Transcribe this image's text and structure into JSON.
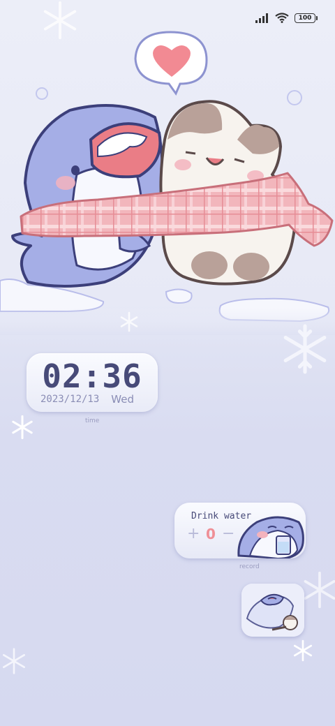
{
  "status_bar": {
    "battery": "100",
    "icons": [
      "signal-icon",
      "wifi-icon",
      "battery-icon"
    ]
  },
  "clock": {
    "time": "02:36",
    "date": "2023/12/13",
    "day": "Wed",
    "caption": "time"
  },
  "water": {
    "title": "Drink water",
    "plus": "+",
    "count": "0",
    "minus": "−",
    "caption": "record"
  },
  "colors": {
    "accent": "#474a78",
    "count": "#ef8f96",
    "background": "#d9dcf1"
  }
}
